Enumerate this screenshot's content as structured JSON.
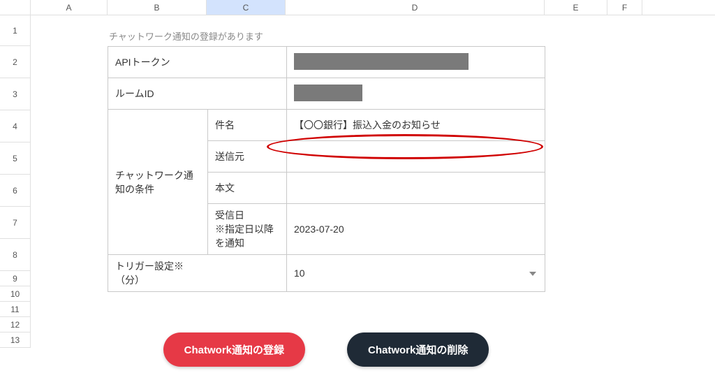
{
  "columns": {
    "A": "A",
    "B": "B",
    "C": "C",
    "D": "D",
    "E": "E",
    "F": "F"
  },
  "rows": [
    "1",
    "2",
    "3",
    "4",
    "5",
    "6",
    "7",
    "8",
    "9",
    "10",
    "11",
    "12",
    "13"
  ],
  "caption": "チャットワーク通知の登録があります",
  "labels": {
    "api_token": "APIトークン",
    "room_id": "ルームID",
    "condition_group": "チャットワーク通知の条件",
    "subject": "件名",
    "sender": "送信元",
    "body": "本文",
    "received": "受信日",
    "received_note": "※指定日以降を通知",
    "trigger": "トリガー設定※",
    "trigger_unit": "（分）"
  },
  "values": {
    "api_token": "",
    "room_id": "",
    "subject": "【〇〇銀行】振込入金のお知らせ",
    "sender": "",
    "body": "",
    "received": "2023-07-20",
    "trigger": "10"
  },
  "buttons": {
    "register": "Chatwork通知の登録",
    "delete": "Chatwork通知の削除"
  }
}
